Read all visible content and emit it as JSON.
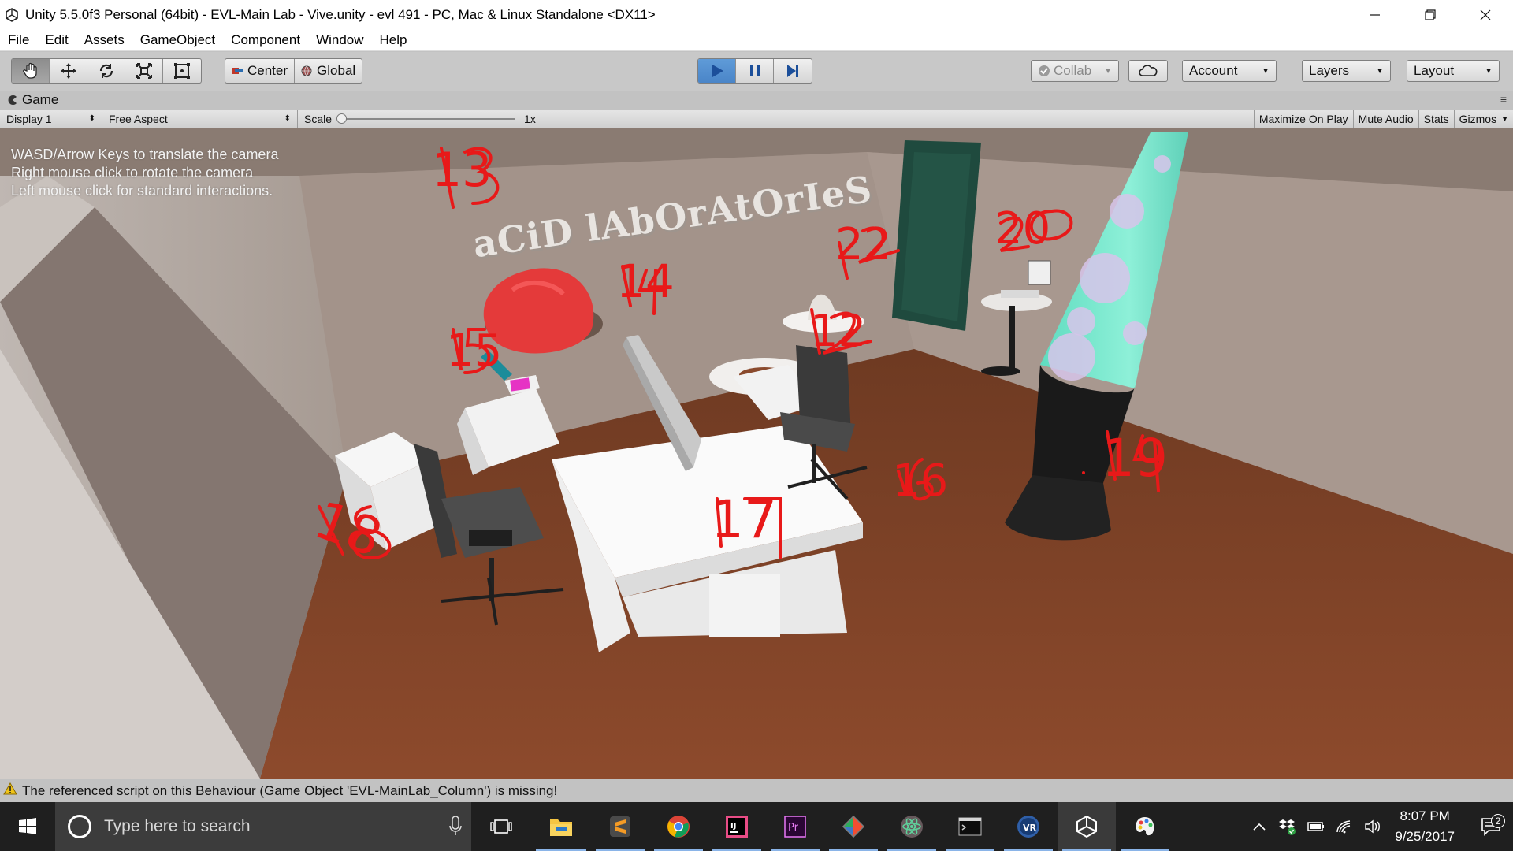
{
  "window": {
    "title": "Unity 5.5.0f3 Personal (64bit) - EVL-Main Lab - Vive.unity - evl 491 - PC, Mac & Linux Standalone <DX11>",
    "controls": [
      "minimize",
      "maximize",
      "close"
    ]
  },
  "menubar": {
    "items": [
      "File",
      "Edit",
      "Assets",
      "GameObject",
      "Component",
      "Window",
      "Help"
    ]
  },
  "toolbar": {
    "tools": [
      "hand-tool",
      "move-tool",
      "rotate-tool",
      "scale-tool",
      "rect-tool"
    ],
    "pivot": {
      "center_label": "Center",
      "global_label": "Global"
    },
    "play_controls": [
      "play",
      "pause",
      "step"
    ],
    "collab_label": "Collab",
    "account_label": "Account",
    "layers_label": "Layers",
    "layout_label": "Layout"
  },
  "panel": {
    "tab_label": "Game",
    "display_label": "Display 1",
    "aspect_label": "Free Aspect",
    "scale_label": "Scale",
    "scale_value": "1x",
    "maximize_label": "Maximize On Play",
    "mute_label": "Mute Audio",
    "stats_label": "Stats",
    "gizmos_label": "Gizmos"
  },
  "game": {
    "instructions": [
      "WASD/Arrow Keys to translate the camera",
      "Right mouse click to rotate the camera",
      "Left mouse click for standard interactions."
    ],
    "sign_text": "aCiD lAbOrAtOrIeS",
    "annotations": [
      "13",
      "14",
      "15",
      "20",
      "22",
      "12",
      "19",
      "16",
      "17",
      "18"
    ],
    "colors": {
      "floor": "#8b4a2c",
      "wall": "#a89487",
      "door": "#1f4a3e",
      "beanbag": "#e63a3a",
      "lava": "#6fe8c8",
      "annotation": "#e81919"
    }
  },
  "status": {
    "message": "The referenced script on this Behaviour (Game Object 'EVL-MainLab_Column') is missing!"
  },
  "taskbar": {
    "search_placeholder": "Type here to search",
    "apps": [
      "task-view",
      "file-explorer",
      "sublime-text",
      "chrome",
      "intellij",
      "premiere",
      "git",
      "atom",
      "terminal",
      "vr-app",
      "unity",
      "paint"
    ],
    "time": "8:07 PM",
    "date": "9/25/2017",
    "notification_count": "2"
  }
}
